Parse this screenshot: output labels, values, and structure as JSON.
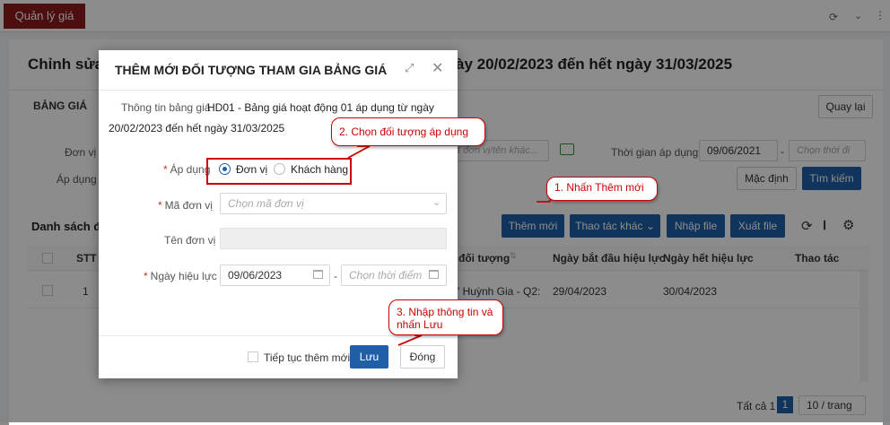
{
  "app": {
    "tab": "Quản lý giá"
  },
  "page": {
    "title_left": "Chỉnh sửa b",
    "title_right": "ày 20/02/2023 đến hết ngày 31/03/2025",
    "section_label": "BẢNG GIÁ",
    "back_button": "Quay lại",
    "filters": {
      "unit_label": "Đơn vị",
      "unit_placeholder": "ã đơn vị/tên khác...",
      "time_label": "Thời gian áp dụng",
      "time_from": "09/06/2021",
      "time_to_placeholder": "Chọn thời đi",
      "apply_label": "Áp dụng",
      "default_button": "Mặc định",
      "search_button": "Tìm kiếm"
    },
    "list_title": "Danh sách đố",
    "toolbar": {
      "add": "Thêm mới",
      "other": "Thao tác khác",
      "import": "Nhập file",
      "export": "Xuất file"
    },
    "table": {
      "headers": {
        "stt": "STT",
        "object": "đối tượng",
        "start": "Ngày bắt đầu hiệu lực",
        "end": "Ngày hết hiệu lực",
        "action": "Thao tác"
      },
      "rows": [
        {
          "stt": "1",
          "object": "' Huỳnh Gia - Q2: ...",
          "start": "29/04/2023",
          "end": "30/04/2023"
        }
      ]
    },
    "pagination": {
      "total": "Tất cả 1",
      "page": "1",
      "page_size": "10 / trang"
    }
  },
  "modal": {
    "title": "THÊM MỚI ĐỐI TƯỢNG THAM GIA BẢNG GIÁ",
    "price_info_label": "Thông tin bảng giá",
    "price_info_value": "HD01 - Bảng giá hoạt động 01 áp dụng từ ngày",
    "price_info_value2": "20/02/2023 đến hết ngày 31/03/2025",
    "apply_label": "Áp dụng",
    "option_unit": "Đơn vị",
    "option_customer": "Khách hàng",
    "unit_code_label": "Mã đơn vị",
    "unit_code_placeholder": "Chọn mã đơn vị",
    "unit_name_label": "Tên đơn vị",
    "effective_label": "Ngày hiệu lực",
    "effective_from": "09/06/2023",
    "effective_to_placeholder": "Chọn thời điểm",
    "continue_label": "Tiếp tục thêm mới",
    "save_button": "Lưu",
    "close_button": "Đóng"
  },
  "callouts": {
    "step1": "1. Nhấn Thêm mới",
    "step2": "2. Chọn đối tượng áp dụng",
    "step3_line1": "3. Nhập thông tin và",
    "step3_line2": "nhấn Lưu"
  }
}
